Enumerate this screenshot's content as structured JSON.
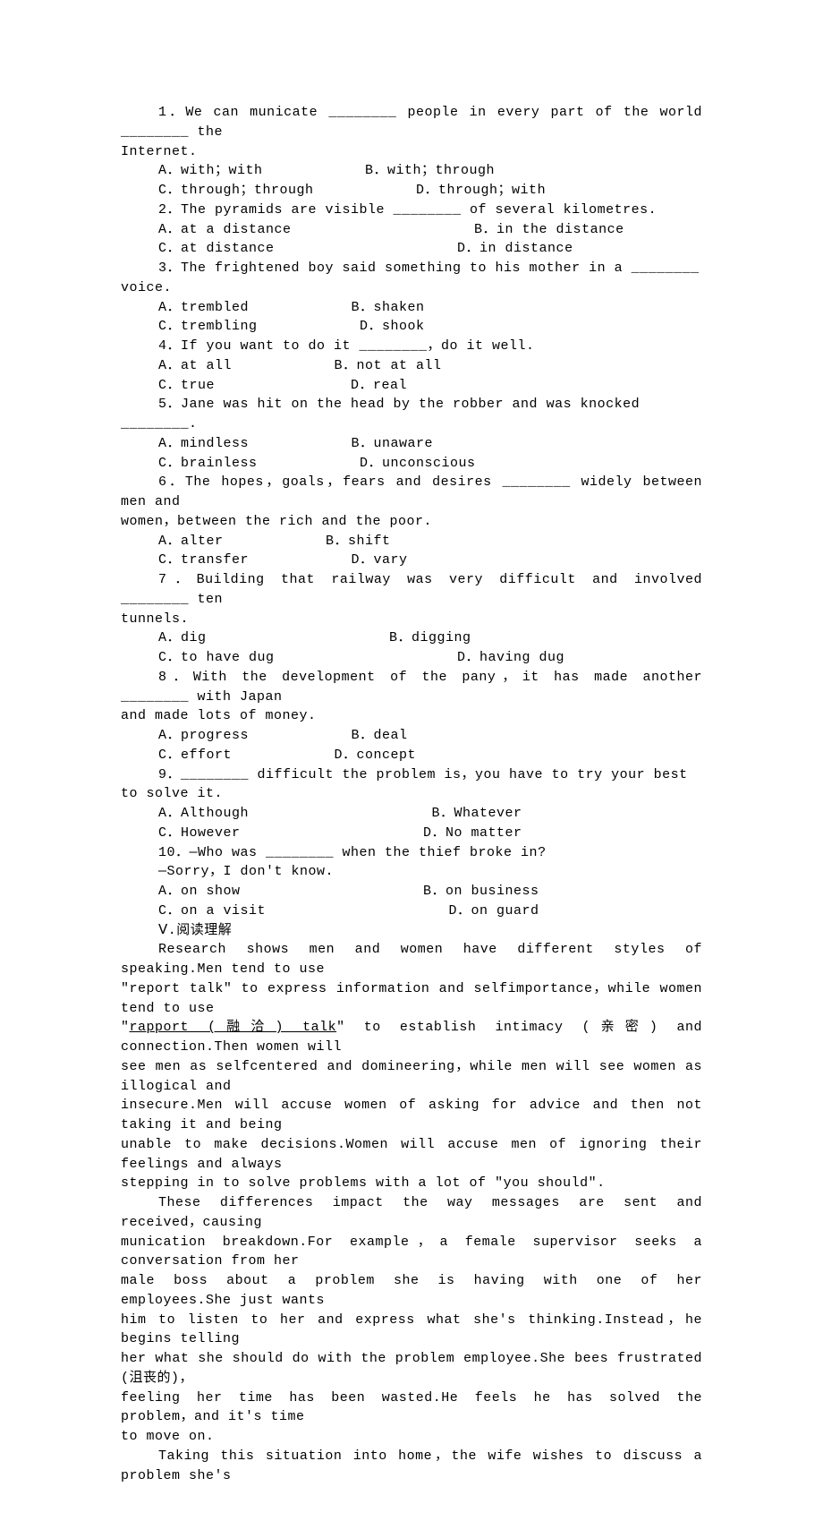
{
  "q1": {
    "stem_a": "1．We can municate ________ people in every part of the world ________ the",
    "stem_b": "Internet.",
    "optA": "A．with；with",
    "optB": "B．with；through",
    "optC": "C．through；through",
    "optD": "D．through；with"
  },
  "q2": {
    "stem": "2．The pyramids are visible ________ of several kilometres.",
    "optA": "A．at a distance",
    "optB": "B．in the distance",
    "optC": "C．at distance",
    "optD": "D．in  distance"
  },
  "q3": {
    "stem": "3．The frightened boy said something to his mother in a ________ voice.",
    "optA": "A．trembled",
    "optB": "B．shaken",
    "optC": "C．trembling",
    "optD": "D．shook"
  },
  "q4": {
    "stem": "4．If you want to do it ________，do it well.",
    "optA": "A．at all",
    "optB": "B．not at all",
    "optC": "C．true",
    "optD": "D．real"
  },
  "q5": {
    "stem": "5．Jane was hit on the head by the robber and was knocked ________.",
    "optA": "A．mindless",
    "optB": "B．unaware",
    "optC": "C．brainless",
    "optD": "D．unconscious"
  },
  "q6": {
    "stem_a": "6．The hopes，goals，fears and desires ________ widely between men and",
    "stem_b": "women，between the rich and the poor.",
    "optA": "A．alter",
    "optB": "B．shift",
    "optC": "C．transfer",
    "optD": "D．vary"
  },
  "q7": {
    "stem_a": "7．Building that railway was very difficult and involved ________ ten",
    "stem_b": "tunnels.",
    "optA": "A．dig",
    "optB": "B．digging",
    "optC": "C．to have dug",
    "optD": "D．having dug"
  },
  "q8": {
    "stem_a": "8．With the development of the pany，it has made another ________ with Japan",
    "stem_b": "and made lots of money.",
    "optA": "A．progress",
    "optB": "B．deal",
    "optC": "C．effort",
    "optD": "D．concept"
  },
  "q9": {
    "stem": "9．________ difficult the problem is，you have to try your best to solve it.",
    "optA": "A．Although",
    "optB": "B．Whatever",
    "optC": "C．However",
    "optD": "D．No matter"
  },
  "q10": {
    "stem": "10．—Who was ________ when the thief broke in?",
    "stem2": "—Sorry，I don't know.",
    "optA": "A．on show",
    "optB": "B．on business",
    "optC": "C．on a visit",
    "optD": "D．on guard"
  },
  "section5": "Ⅴ.阅读理解",
  "passage": {
    "p1a": "Research shows men and women have different styles of speaking.Men tend to use",
    "p1b_pre": "\"report talk\" to express information and self­importance，while women tend to use",
    "p1c_pre": "\"",
    "p1c_ul": "rapport (融洽) talk",
    "p1c_post": "\" to establish intimacy (亲密) and connection.Then women will",
    "p1d": "see men as self­centered and domineering，while men will see women as illogical and",
    "p1e": "insecure.Men will accuse women of asking for advice and then not taking it and being",
    "p1f": "unable to make decisions.Women will accuse men of ignoring their feelings and always",
    "p1g": "stepping in to solve problems with a lot of \"you should\".",
    "p2a": "These differences impact the way messages are sent and received，causing",
    "p2b": "munication breakdown.For example，a female supervisor seeks a conversation from her",
    "p2c": "male boss about a problem she is having with one of her employees.She just wants",
    "p2d": "him to listen to her and express what she's thinking.Instead，he begins telling",
    "p2e": "her what she should do with the problem employee.She bees frustrated (沮丧的)，",
    "p2f": "feeling her time has been wasted.He feels he has solved the problem，and it's time",
    "p2g": "to move on.",
    "p3": "Taking this situation into home，the wife wishes to discuss a problem she's"
  }
}
